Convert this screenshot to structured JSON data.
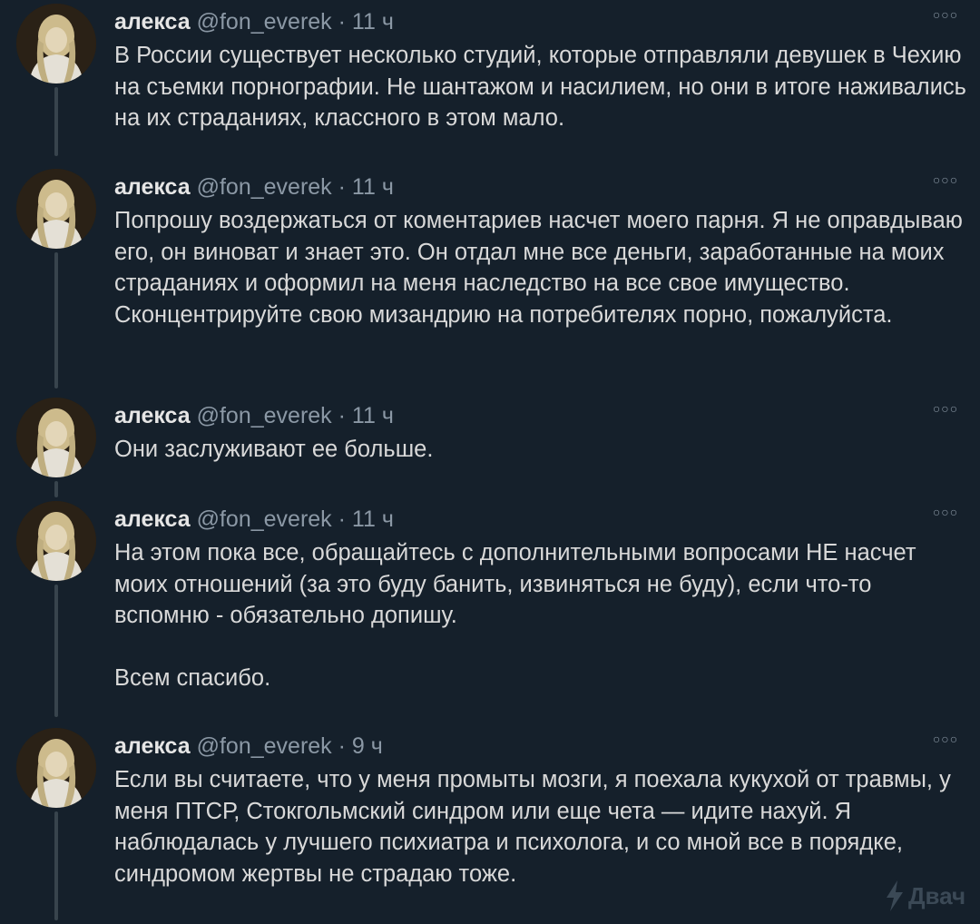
{
  "tweets": [
    {
      "name": "алекса",
      "handle": "@fon_everek",
      "sep": "·",
      "time": "11 ч",
      "text": "В России существует несколько студий, которые отправляли девушек в Чехию на съемки порнографии. Не шантажом и насилием, но они в итоге наживались на их страданиях, классного в этом мало."
    },
    {
      "name": "алекса",
      "handle": "@fon_everek",
      "sep": "·",
      "time": "11 ч",
      "text": "Попрошу воздержаться от коментариев насчет моего парня. Я не оправдываю его, он виноват и знает это. Он отдал мне все деньги, заработанные на моих страданиях и оформил на меня наследство на все свое имущество.\nСконцентрируйте свою мизандрию на потребителях порно, пожалуйста."
    },
    {
      "name": "алекса",
      "handle": "@fon_everek",
      "sep": "·",
      "time": "11 ч",
      "text": "Они заслуживают ее больше."
    },
    {
      "name": "алекса",
      "handle": "@fon_everek",
      "sep": "·",
      "time": "11 ч",
      "text": "На этом пока все, обращайтесь с дополнительными вопросами НЕ насчет моих отношений (за это буду банить, извиняться не буду), если что-то вспомню - обязательно допишу.\n\nВсем спасибо."
    },
    {
      "name": "алекса",
      "handle": "@fon_everek",
      "sep": "·",
      "time": "9 ч",
      "text": "Если вы считаете, что у меня промыты мозги, я поехала кукухой от травмы, у меня ПТСР, Стокгольмский синдром или еще чета — идите нахуй. Я наблюдалась у лучшего психиатра и психолога, и со мной все в порядке, синдромом жертвы не страдаю тоже."
    }
  ],
  "more_icon": "more-dots-icon",
  "watermark": {
    "text": "Двач",
    "icon": "lightning-icon"
  },
  "colors": {
    "background": "#15202b",
    "text": "#d9d9d9",
    "name": "#e6e6e6",
    "meta": "#8b98a5",
    "thread_line": "#38444d"
  }
}
